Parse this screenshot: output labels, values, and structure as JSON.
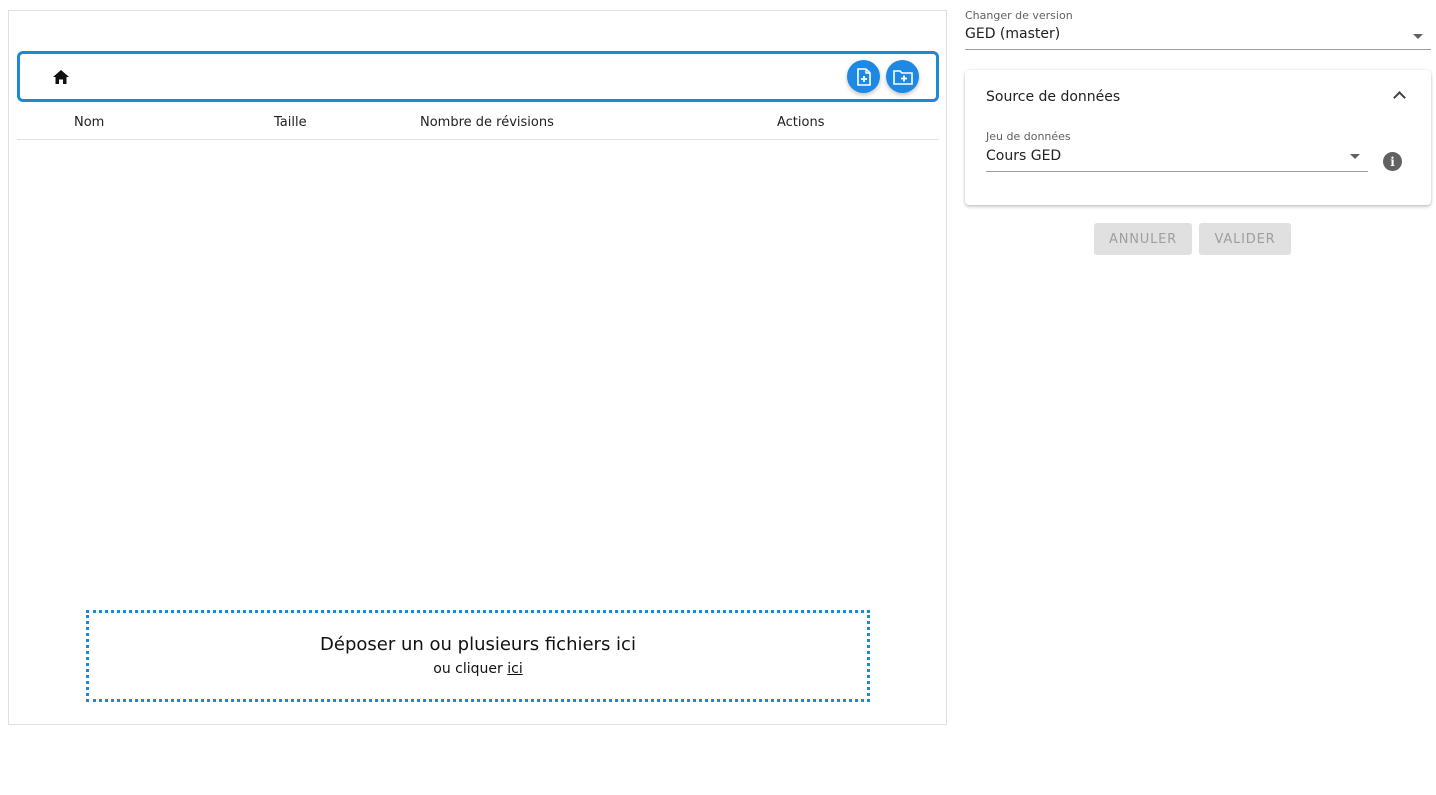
{
  "file_browser": {
    "table_headers": {
      "name": "Nom",
      "size": "Taille",
      "revisions": "Nombre de révisions",
      "actions": "Actions"
    },
    "rows": [],
    "toolbar": {
      "home_icon": "home-icon",
      "add_file_icon": "file-plus-icon",
      "add_folder_icon": "folder-plus-icon"
    },
    "dropzone": {
      "title": "Déposer un ou plusieurs fichiers ici",
      "sub_prefix": "ou cliquer",
      "link": "ici"
    }
  },
  "sidebar": {
    "version": {
      "label": "Changer de version",
      "value": "GED (master)"
    },
    "data_source": {
      "title": "Source de données",
      "dataset_label": "Jeu de données",
      "dataset_value": "Cours GED",
      "info_icon": "info-icon"
    },
    "buttons": {
      "cancel": "ANNULER",
      "validate": "VALIDER"
    }
  },
  "colors": {
    "accent": "#1e88e5",
    "toolbar_border": "#1e88d2",
    "disabled_button": "#e0e0e0"
  }
}
